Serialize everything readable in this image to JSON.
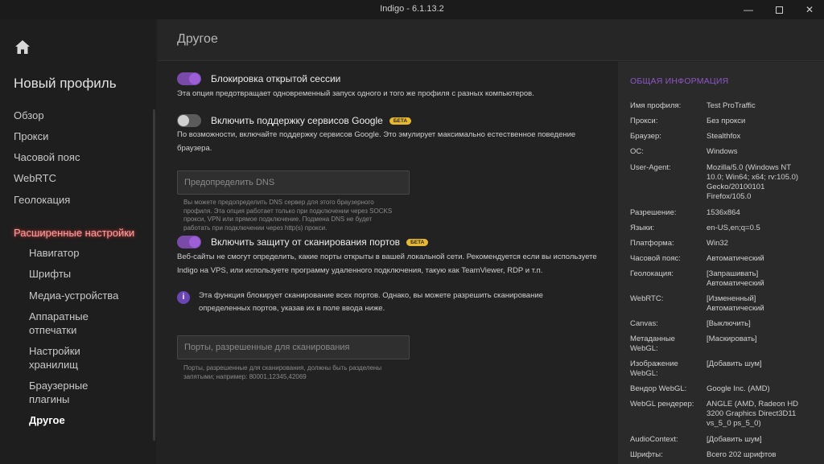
{
  "window": {
    "title": "Indigo - 6.1.13.2",
    "minimize_label": "—",
    "close_label": "✕"
  },
  "sidebar": {
    "profile_title": "Новый профиль",
    "items": [
      "Обзор",
      "Прокси",
      "Часовой пояс",
      "WebRTC",
      "Геолокация"
    ],
    "section": "Расширенные настройки",
    "subitems": [
      "Навигатор",
      "Шрифты",
      "Медиа-устройства",
      "Аппаратные отпечатки",
      "Настройки хранилищ",
      "Браузерные плагины",
      "Другое"
    ]
  },
  "page": {
    "title": "Другое"
  },
  "options": {
    "session_lock": {
      "title": "Блокировка открытой сессии",
      "description": "Эта опция предотвращает одновременный запуск одного и того же профиля с разных компьютеров.",
      "enabled": true
    },
    "google_services": {
      "title": "Включить поддержку сервисов Google",
      "badge": "БЕТА",
      "description": "По возможности, включайте поддержку сервисов Google. Это эмулирует максимально естественное поведение браузера.",
      "enabled": false
    },
    "dns": {
      "placeholder": "Предопределить DNS",
      "hint": "Вы можете предопределить DNS сервер для этого браузерного профиля. Эта опция работает только при подключении через SOCKS прокси, VPN или прямое подключение. Подмена DNS не будет работать при подключении через http(s) прокси."
    },
    "port_scan": {
      "title": "Включить защиту от сканирования портов",
      "badge": "БЕТА",
      "description": "Веб-сайты не смогут определить, какие порты открыты в вашей локальной сети. Рекомендуется если вы используете Indigo на VPS, или используете программу удаленного подключения, такую как TeamViewer, RDP и т.п.",
      "enabled": true,
      "info": "Эта функция блокирует сканирование всех портов. Однако, вы можете разрешить сканирование определенных портов, указав их в поле ввода ниже."
    },
    "ports": {
      "placeholder": "Порты, разрешенные для сканирования",
      "hint": "Порты, разрешенные для сканирования, должны быть разделены запятыми; например: 80001,12345,42069"
    }
  },
  "info_panel": {
    "heading": "ОБЩАЯ ИНФОРМАЦИЯ",
    "rows": [
      {
        "key": "Имя профиля:",
        "value": "Test ProTraffic"
      },
      {
        "key": "Прокси:",
        "value": "Без прокси"
      },
      {
        "key": "Браузер:",
        "value": "Stealthfox"
      },
      {
        "key": "ОС:",
        "value": "Windows"
      },
      {
        "key": "User-Agent:",
        "value": "Mozilla/5.0 (Windows NT 10.0; Win64; x64; rv:105.0) Gecko/20100101 Firefox/105.0"
      },
      {
        "key": "Разрешение:",
        "value": "1536x864"
      },
      {
        "key": "Языки:",
        "value": "en-US,en;q=0.5"
      },
      {
        "key": "Платформа:",
        "value": "Win32"
      },
      {
        "key": "Часовой пояс:",
        "value": "Автоматический"
      },
      {
        "key": "Геолокация:",
        "value": "[Запрашивать] Автоматический"
      },
      {
        "key": "WebRTC:",
        "value": "[Измененный] Автоматический"
      },
      {
        "key": "Canvas:",
        "value": "[Выключить]"
      },
      {
        "key": "Метаданные WebGL:",
        "value": "[Маскировать]"
      },
      {
        "key": "Изображение WebGL:",
        "value": "[Добавить шум]"
      },
      {
        "key": "Вендор WebGL:",
        "value": "Google Inc. (AMD)"
      },
      {
        "key": "WebGL рендерер:",
        "value": "ANGLE (AMD, Radeon HD 3200 Graphics Direct3D11 vs_5_0 ps_5_0)"
      },
      {
        "key": "AudioContext:",
        "value": "[Добавить шум]"
      },
      {
        "key": "Шрифты:",
        "value": "Всего 202 шрифтов"
      }
    ]
  }
}
